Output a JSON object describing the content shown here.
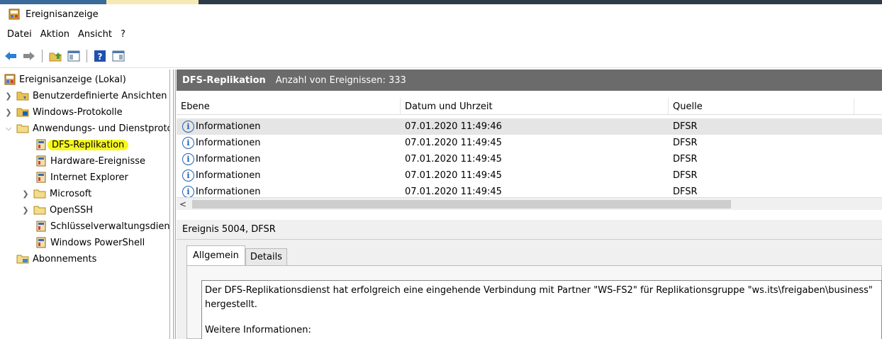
{
  "window": {
    "title": "Ereignisanzeige"
  },
  "menu": [
    "Datei",
    "Aktion",
    "Ansicht",
    "?"
  ],
  "toolbar": {
    "icons": [
      "back-arrow-icon",
      "forward-arrow-icon",
      "folder-up-icon",
      "show-hide-tree-icon",
      "help-icon",
      "show-hide-action-pane-icon"
    ]
  },
  "tree": {
    "root": "Ereignisanzeige (Lokal)",
    "items": [
      {
        "label": "Benutzerdefinierte Ansichten"
      },
      {
        "label": "Windows-Protokolle"
      },
      {
        "label": "Anwendungs- und Dienstprotokolle"
      },
      {
        "label": "DFS-Replikation"
      },
      {
        "label": "Hardware-Ereignisse"
      },
      {
        "label": "Internet Explorer"
      },
      {
        "label": "Microsoft"
      },
      {
        "label": "OpenSSH"
      },
      {
        "label": "Schlüsselverwaltungsdienst"
      },
      {
        "label": "Windows PowerShell"
      },
      {
        "label": "Abonnements"
      }
    ],
    "highlight_color": "#f7f71e"
  },
  "main": {
    "header_title": "DFS-Replikation",
    "header_count": "Anzahl von Ereignissen: 333",
    "columns": [
      "Ebene",
      "Datum und Uhrzeit",
      "Quelle"
    ],
    "rows": [
      {
        "level": "Informationen",
        "datetime": "07.01.2020 11:49:46",
        "source": "DFSR"
      },
      {
        "level": "Informationen",
        "datetime": "07.01.2020 11:49:45",
        "source": "DFSR"
      },
      {
        "level": "Informationen",
        "datetime": "07.01.2020 11:49:45",
        "source": "DFSR"
      },
      {
        "level": "Informationen",
        "datetime": "07.01.2020 11:49:45",
        "source": "DFSR"
      },
      {
        "level": "Informationen",
        "datetime": "07.01.2020 11:49:45",
        "source": "DFSR"
      }
    ],
    "scroll_left": "<"
  },
  "detail": {
    "title": "Ereignis 5004, DFSR",
    "tabs": [
      "Allgemein",
      "Details"
    ],
    "line1": "Der DFS-Replikationsdienst hat erfolgreich eine eingehende Verbindung mit Partner \"WS-FS2\" für Replikationsgruppe \"ws.its\\freigaben\\business\"",
    "line2": "hergestellt.",
    "line3": "Weitere Informationen:"
  },
  "colors": {
    "header_bg": "#6b6b6b",
    "selected_row": "#e5e5e5",
    "info_blue": "#2060b0"
  }
}
